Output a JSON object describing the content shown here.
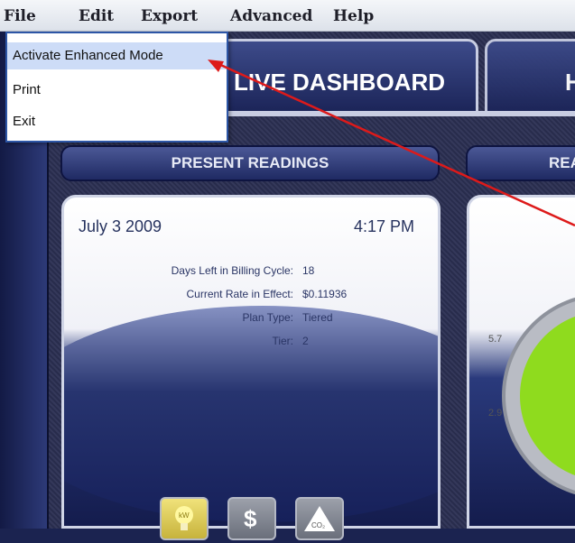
{
  "menubar": {
    "items": [
      "File",
      "Edit",
      "Export",
      "Advanced",
      "Help"
    ]
  },
  "file_menu": {
    "items": [
      "Activate Enhanced Mode",
      "Print",
      "Exit"
    ],
    "highlighted_index": 0
  },
  "tabs": {
    "live_dashboard": "LIVE DASHBOARD",
    "second_tab_partial": "H"
  },
  "present_readings": {
    "header": "PRESENT READINGS",
    "date": "July 3 2009",
    "time": "4:17 PM",
    "fields": [
      {
        "label": "Days Left in Billing Cycle:",
        "value": "18"
      },
      {
        "label": "Current Rate in Effect:",
        "value": "$0.11936"
      },
      {
        "label": "Plan Type:",
        "value": "Tiered"
      },
      {
        "label": "Tier:",
        "value": "2"
      }
    ]
  },
  "right_section": {
    "header_partial": "REA"
  },
  "gauge": {
    "labels": [
      "5.7",
      "2.9"
    ]
  },
  "buttons": {
    "kw_label": "kW",
    "dollar_label": "$",
    "co2_label": "CO₂"
  },
  "colors": {
    "accent_arrow": "#dd1a1a",
    "menu_highlight": "#cddcf7",
    "gauge_green": "#8fdb1e"
  }
}
